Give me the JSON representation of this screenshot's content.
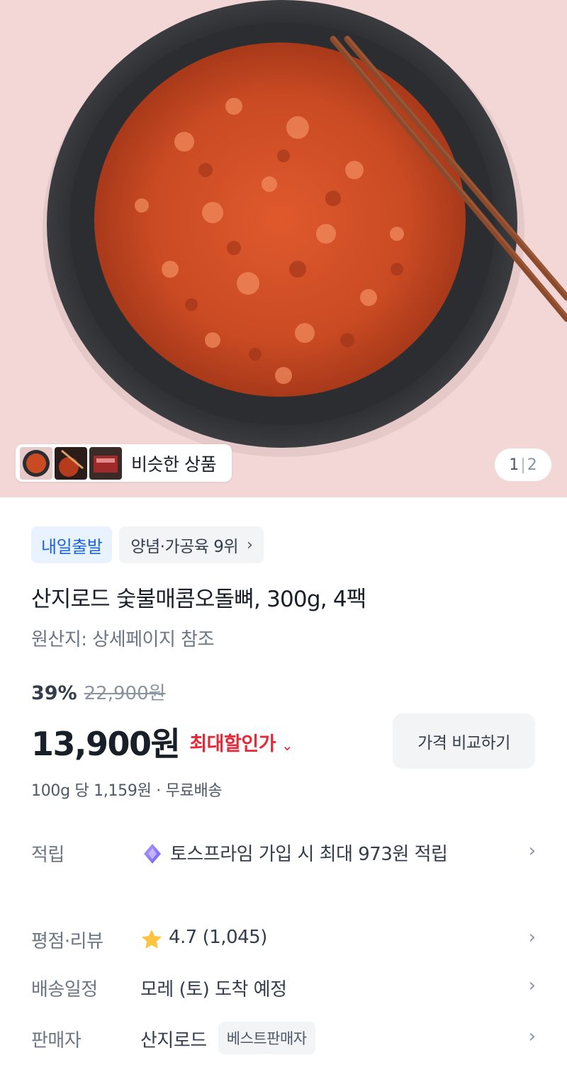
{
  "gallery": {
    "similar_label": "비슷한 상품",
    "current_page": "1",
    "separator": "|",
    "total_pages": "2"
  },
  "badges": {
    "shipping": "내일출발",
    "rank": "양념·가공육 9위",
    "rank_chevron": "›"
  },
  "product": {
    "title": "산지로드 숯불매콤오돌뼈, 300g, 4팩",
    "origin": "원산지: 상세페이지 참조"
  },
  "price": {
    "discount_percent": "39%",
    "original": "22,900원",
    "final": "13,900원",
    "max_discount_label": "최대할인가",
    "max_discount_arrow": "⌄",
    "compare_button": "가격 비교하기",
    "unit_info": "100g 당 1,159원 · 무료배송"
  },
  "info": {
    "points": {
      "label": "적립",
      "value": "토스프라임 가입 시 최대 973원 적립",
      "chevron": "›"
    },
    "rating": {
      "label": "평점·리뷰",
      "value": "4.7 (1,045)",
      "chevron": "›"
    },
    "delivery": {
      "label": "배송일정",
      "value": "모레 (토) 도착 예정",
      "chevron": "›"
    },
    "seller": {
      "label": "판매자",
      "value": "산지로드",
      "badge": "베스트판매자",
      "chevron": "›"
    }
  },
  "colors": {
    "accent_blue": "#1b64da",
    "discount_red": "#e42939",
    "star_yellow": "#ffc342",
    "hero_background": "#f3d6d6"
  },
  "icons": {
    "prime": "toss-prime-icon",
    "star": "star-icon",
    "chevron": "chevron-right-icon"
  }
}
